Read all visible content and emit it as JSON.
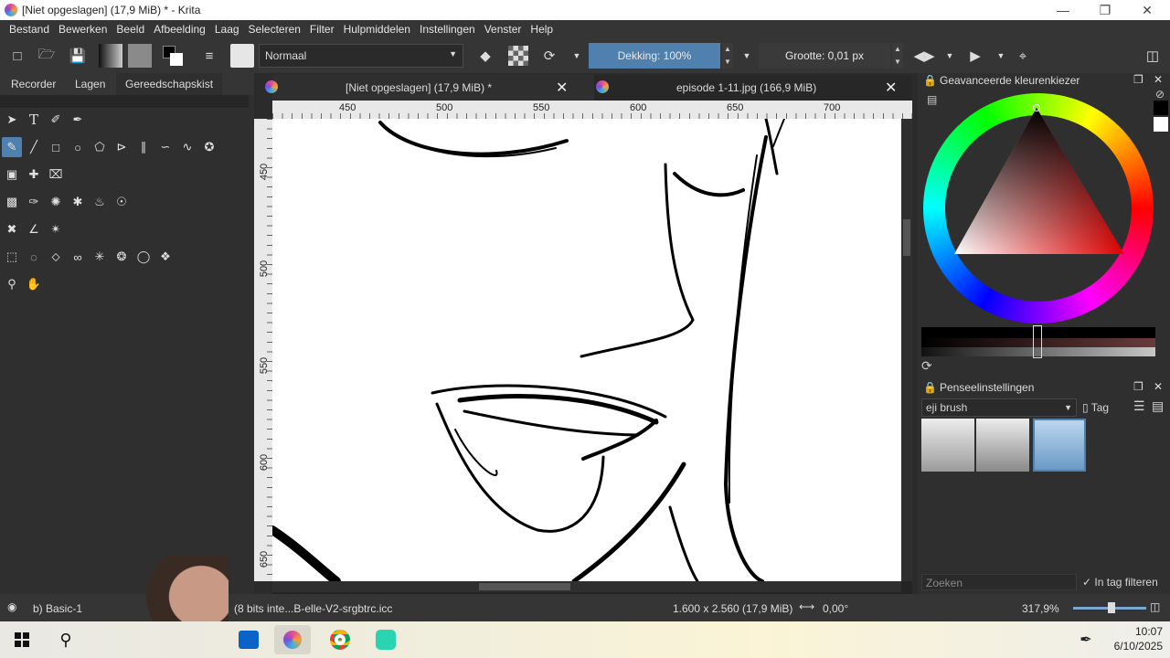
{
  "window": {
    "title": "[Niet opgeslagen]  (17,9 MiB) * - Krita"
  },
  "menu": [
    "Bestand",
    "Bewerken",
    "Beeld",
    "Afbeelding",
    "Laag",
    "Selecteren",
    "Filter",
    "Hulpmiddelen",
    "Instellingen",
    "Venster",
    "Help"
  ],
  "toolbar": {
    "blend_mode": "Normaal",
    "opacity_label": "Dekking: 100%",
    "size_label": "Grootte: 0,01 px"
  },
  "docker_tabs": [
    "Recorder",
    "Lagen",
    "Gereedschapskist"
  ],
  "canvas_tabs": [
    {
      "label": "[Niet opgeslagen]  (17,9 MiB) *"
    },
    {
      "label": "episode 1-11.jpg (166,9 MiB)"
    }
  ],
  "ruler_h": [
    "450",
    "500",
    "550",
    "600",
    "650",
    "700"
  ],
  "ruler_v": [
    "450",
    "500",
    "550",
    "600",
    "650"
  ],
  "color_selector": {
    "title": "Geavanceerde kleurenkiezer"
  },
  "brush_settings": {
    "title": "Penseelinstellingen",
    "preset_combo": "eji brush",
    "tag_label": "Tag",
    "search_placeholder": "Zoeken",
    "filter_label": "In tag filteren"
  },
  "status": {
    "brush": "b) Basic-1",
    "profile": "(8 bits inte...B-elle-V2-srgbtrc.icc",
    "dimensions": "1.600 x 2.560 (17,9 MiB)",
    "rotation": "0,00°",
    "zoom": "317,9%"
  },
  "taskbar": {
    "time": "10:07",
    "date": "6/10/2025"
  }
}
